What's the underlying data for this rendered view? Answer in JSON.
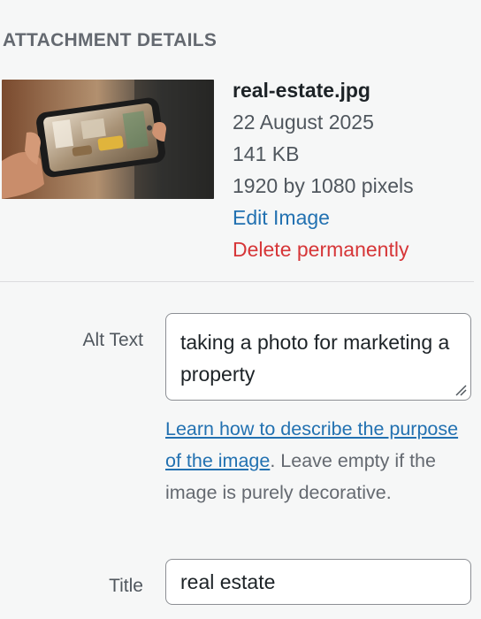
{
  "section": {
    "title": "ATTACHMENT DETAILS"
  },
  "attachment": {
    "filename": "real-estate.jpg",
    "date": "22 August 2025",
    "size": "141 KB",
    "dimensions": "1920 by 1080 pixels",
    "edit_label": "Edit Image",
    "delete_label": "Delete permanently"
  },
  "fields": {
    "alt_text": {
      "label": "Alt Text",
      "value": "taking a photo for marketing a property",
      "help_link": "Learn how to describe the purpose of the image",
      "help_text": ". Leave empty if the image is purely decorative."
    },
    "title": {
      "label": "Title",
      "value": "real estate"
    }
  },
  "colors": {
    "background": "#f6f7f7",
    "link": "#2271b1",
    "delete": "#d63638",
    "border": "#8c8f94"
  },
  "icons": {
    "textarea_resize": "resize-grip-icon"
  }
}
